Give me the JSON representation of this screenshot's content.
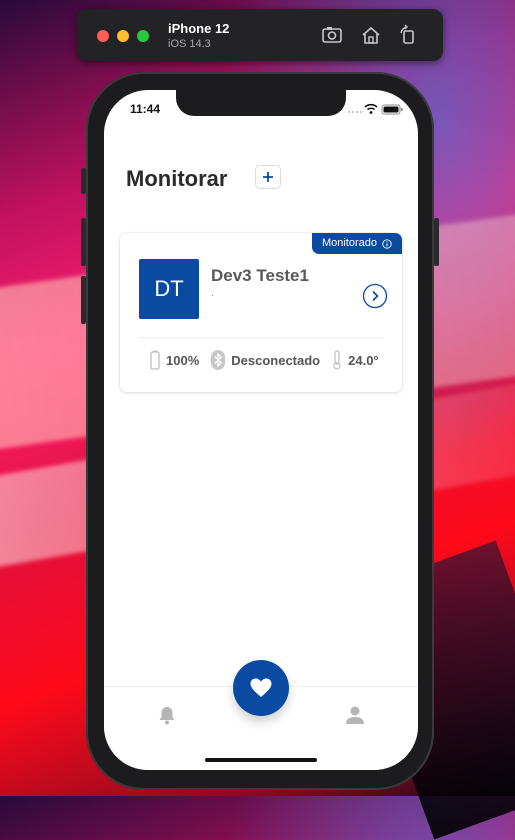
{
  "simulator": {
    "device": "iPhone 12",
    "os": "iOS 14.3",
    "icons": [
      "screenshot-icon",
      "home-icon",
      "rotate-icon"
    ]
  },
  "status_bar": {
    "time": "11:44"
  },
  "page": {
    "title": "Monitorar",
    "add_label": "+"
  },
  "devices": [
    {
      "badge": "Monitorado",
      "initials": "DT",
      "name": "Dev3 Teste1",
      "subtitle": ".",
      "battery": "100%",
      "bluetooth": "Desconectado",
      "temperature": "24.0°"
    }
  ],
  "tabbar": {
    "items": [
      "notifications-icon",
      "heart-icon",
      "profile-icon"
    ]
  },
  "colors": {
    "accent": "#0b4aa2",
    "text": "#2b2b2b"
  }
}
